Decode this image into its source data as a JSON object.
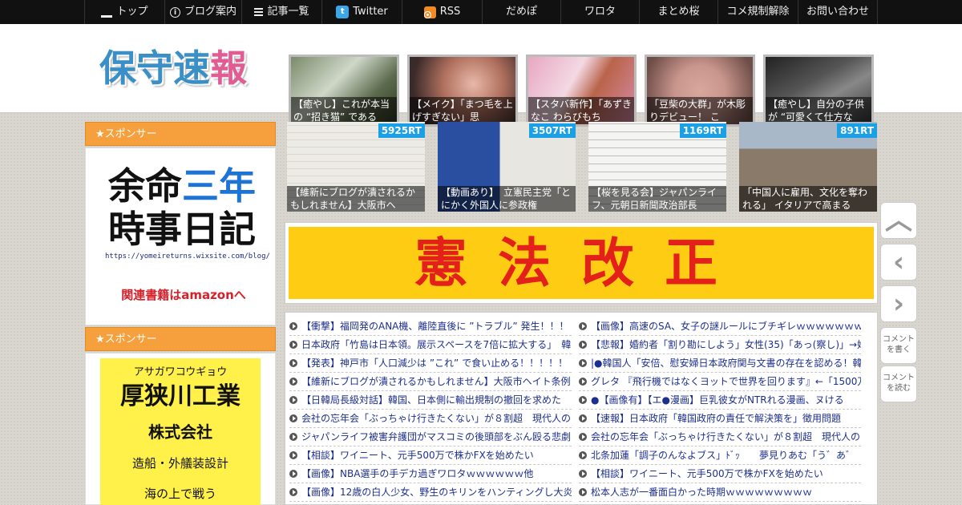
{
  "nav": {
    "items": [
      {
        "label": "トップ",
        "icon": "home-icon"
      },
      {
        "label": "ブログ案内",
        "icon": "info-icon"
      },
      {
        "label": "記事一覧",
        "icon": "list-icon"
      },
      {
        "label": "Twitter",
        "icon": "twitter-icon"
      },
      {
        "label": "RSS",
        "icon": "rss-icon"
      },
      {
        "label": "だめぽ"
      },
      {
        "label": "ワロタ"
      },
      {
        "label": "まとめ桜"
      },
      {
        "label": "コメ規制解除"
      },
      {
        "label": "お問い合わせ"
      }
    ]
  },
  "header": {
    "logo_part1": "保守",
    "logo_part2": "速",
    "logo_part3": "報",
    "features": [
      {
        "caption": "【癒やし】これが本当の “招き猫” である"
      },
      {
        "caption": "【メイク】「まつ毛を上げすぎない」思"
      },
      {
        "caption": "【スタバ新作】「あずきなこ わらびもち"
      },
      {
        "caption": "「豆柴の大群」が木彫りデビュー！ こ"
      },
      {
        "caption": "【癒やし】自分の子供が “可愛くて仕方な"
      }
    ]
  },
  "sidebar": {
    "sponsor_label": "★スポンサー",
    "ad1": {
      "line1": "余命",
      "line1_blue": "三年",
      "line2": "時事日記",
      "url": "https://yomeireturns.wixsite.com/blog/",
      "link": "関連書籍はamazonへ"
    },
    "ad2": {
      "kana": "アサガワコウギョウ",
      "name": "厚狭川工業",
      "company": "株式会社",
      "desc": "造船・外艤装設計",
      "more": "海の上で戦う"
    }
  },
  "rt_cards": [
    {
      "badge": "5925RT",
      "caption": "【維新にブログが潰されるかもしれません】大阪市ヘ"
    },
    {
      "badge": "3507RT",
      "caption": "【動画あり】　立憲民主党「とにかく外国人に参政権"
    },
    {
      "badge": "1169RT",
      "caption": "【桜を見る会】ジャパンライフ、元朝日新聞政治部長"
    },
    {
      "badge": "891RT",
      "caption": "「中国人に雇用、文化を奪われる」 イタリアで高まる"
    }
  ],
  "banner": {
    "text": "憲法改正"
  },
  "headlines": {
    "left": [
      "【衝撃】福岡発のANA機、離陸直後に ”トラブル” 発生！！！",
      "日本政府「竹島は日本領。展示スペースを7倍に拡大する」　韓",
      "【発表】神戸市「人口減少は ”これ” で食い止める！！！！！",
      "【維新にブログが潰されるかもしれません】大阪市ヘイト条例",
      "【日韓局長級対話】韓国、日本側に輸出規制の撤回を求めた",
      "会社の忘年会「ぶっちゃけ行きたくない」が８割超　現代人の",
      "ジャパンライフ被害弁護団がマスコミの後頭部をぶん殴る悲劇",
      "【相談】ワイニート、元手500万で株かFXを始めたい",
      "【画像】NBA選手の手デカ過ぎワロタｗｗｗｗｗｗ他",
      "【画像】12歳の白人少女、野生のキリンをハンティングし大炎"
    ],
    "right": [
      "【画像】高速のSA、女子の謎ルールにブチギレｗｗｗｗｗｗｗ",
      "【悲報】婚約者「割り勘にしよう」女性(35)「あっ(察し)」→婚",
      "|●韓国人「安倍、慰安婦日本政府関与文書の存在を認める！韓",
      "グレタ 『飛行機ではなくヨットで世界を回ります』←「1500万",
      "●【画像有】【エ●漫画】巨乳彼女がNTRれる漫画、ヌける",
      "【速報】日本政府「韓国政府の責任で解決策を」徴用問題",
      "会社の忘年会「ぶっちゃけ行きたくない」が８割超　現代人の",
      "北条加蓮「調子のんなよブス」ﾄﾞｯ　　夢見りあむ「う゛あ゛",
      "【相談】ワイニート、元手500万で株かFXを始めたい",
      "松本人志が一番面白かった時期ｗｗｗｗｗｗｗｗｗ"
    ]
  },
  "tools": {
    "comment_write": "コメントを書く",
    "comment_read": "コメントを読む"
  },
  "colors": {
    "accent": "#f5a03c",
    "rt_badge": "#1aa0e6",
    "banner_bg": "#ffcc14",
    "banner_text": "#e3201a",
    "link": "#1c2f8c"
  }
}
